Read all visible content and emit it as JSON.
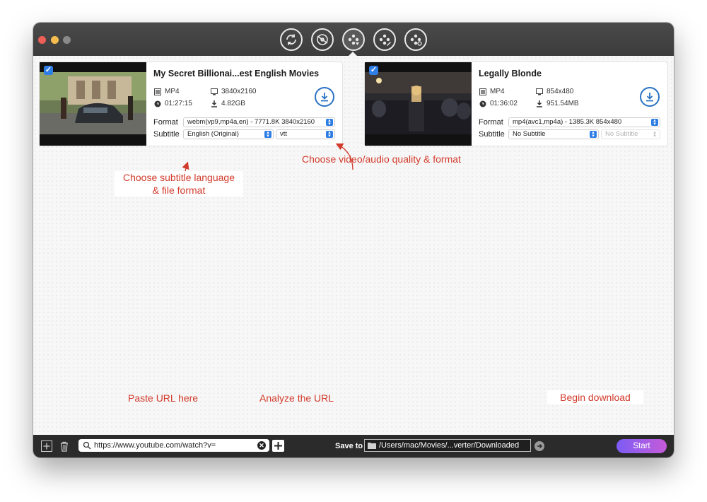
{
  "toolbar": {
    "icons": [
      "convert-icon",
      "burn-icon",
      "download-icon",
      "edit-icon",
      "toolbox-icon"
    ],
    "active_index": 2
  },
  "cards": [
    {
      "title": "My Secret Billionai...est English Movies",
      "container": "MP4",
      "resolution": "3840x2160",
      "duration": "01:27:15",
      "size": "4.82GB",
      "format_label": "Format",
      "format_value": "webm(vp9,mp4a,en) - 7771.8K 3840x2160",
      "subtitle_label": "Subtitle",
      "subtitle_value": "English (Original)",
      "subtitle_format": "vtt",
      "checked": true
    },
    {
      "title": "Legally Blonde",
      "container": "MP4",
      "resolution": "854x480",
      "duration": "01:36:02",
      "size": "951.54MB",
      "format_label": "Format",
      "format_value": "mp4(avc1,mp4a) - 1385.3K 854x480",
      "subtitle_label": "Subtitle",
      "subtitle_value": "No Subtitle",
      "subtitle_format": "No Subtitle",
      "checked": true
    }
  ],
  "annotations": {
    "quality": "Choose video/audio quality & format",
    "subtitle_line1": "Choose subtitle language",
    "subtitle_line2": "& file format",
    "paste_url": "Paste URL here",
    "analyze_url": "Analyze the URL",
    "begin_download": "Begin download"
  },
  "bottom": {
    "url_value": "https://www.youtube.com/watch?v=",
    "save_to_label": "Save to",
    "save_path": "/Users/mac/Movies/...verter/Downloaded",
    "start_label": "Start"
  },
  "colors": {
    "accent": "#2f7ee6",
    "annotation": "#d23a2b",
    "start_gradient_from": "#7d5cf5",
    "start_gradient_to": "#c65bd9"
  }
}
